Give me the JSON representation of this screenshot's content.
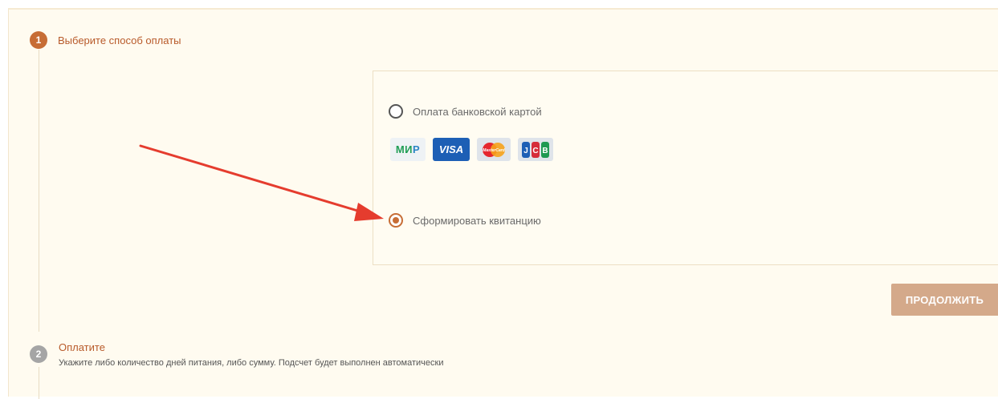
{
  "steps": [
    {
      "number": "1",
      "title": "Выберите способ оплаты",
      "state": "active"
    },
    {
      "number": "2",
      "title": "Оплатите",
      "description": "Укажите либо количество дней питания, либо сумму. Подсчет будет выполнен автоматически",
      "state": "inactive"
    }
  ],
  "payment_options": [
    {
      "label": "Оплата банковской картой",
      "selected": false
    },
    {
      "label": "Сформировать квитанцию",
      "selected": true
    }
  ],
  "card_logos": {
    "mir_prefix": "МИ",
    "mir_suffix": "Р",
    "visa": "VISA",
    "mastercard": "MasterCard",
    "jcb": [
      "J",
      "C",
      "B"
    ]
  },
  "continue_label": "ПРОДОЛЖИТЬ",
  "colors": {
    "accent": "#c76d35",
    "button": "#d4a98a",
    "panel_bg": "#fffbf0",
    "arrow": "#e53c2e"
  }
}
